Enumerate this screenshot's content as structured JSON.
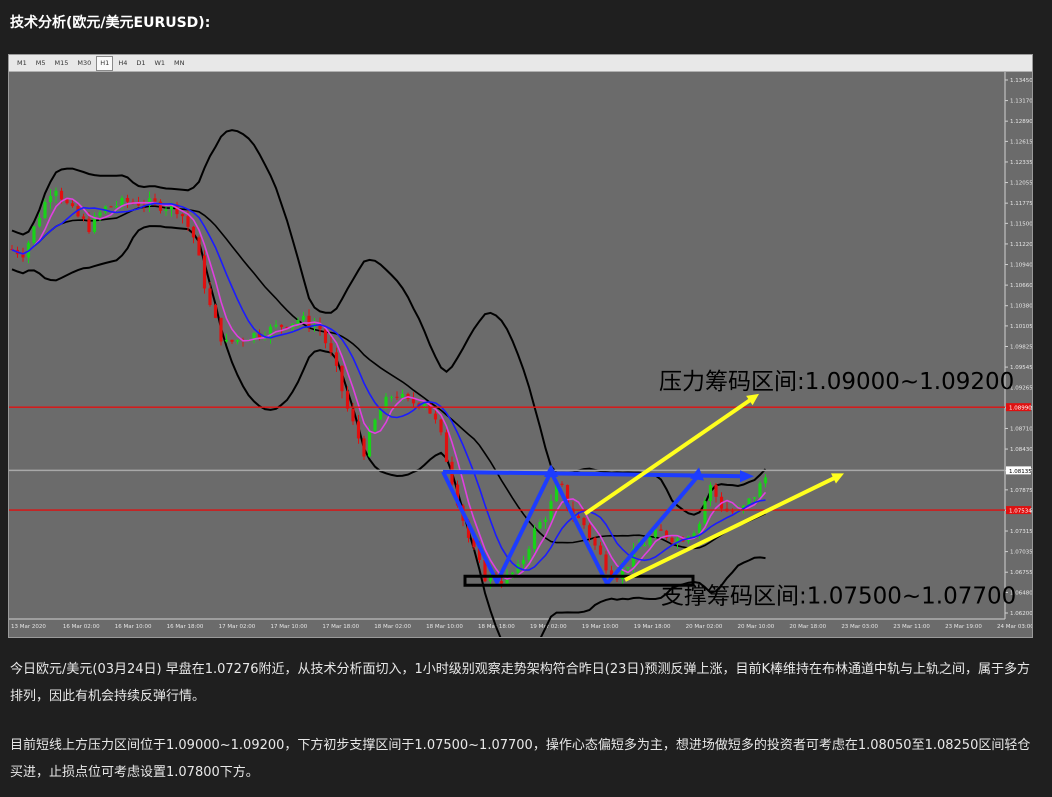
{
  "heading": "技术分析(欧元/美元EURUSD):",
  "timeframes": [
    {
      "label": "M1",
      "active": false
    },
    {
      "label": "M5",
      "active": false
    },
    {
      "label": "M15",
      "active": false
    },
    {
      "label": "M30",
      "active": false
    },
    {
      "label": "H1",
      "active": true
    },
    {
      "label": "H4",
      "active": false
    },
    {
      "label": "D1",
      "active": false
    },
    {
      "label": "W1",
      "active": false
    },
    {
      "label": "MN",
      "active": false
    }
  ],
  "chart_data": {
    "type": "candlestick",
    "symbol": "EURUSD",
    "timeframe": "H1",
    "y_ticks": [
      "1.13450",
      "1.13170",
      "1.12890",
      "1.12615",
      "1.12335",
      "1.12055",
      "1.11775",
      "1.11500",
      "1.11220",
      "1.10940",
      "1.10660",
      "1.10380",
      "1.10105",
      "1.09825",
      "1.09545",
      "1.09265",
      "1.08990",
      "1.08710",
      "1.08430",
      "1.08135",
      "1.07875",
      "1.07595",
      "1.07315",
      "1.07035",
      "1.06755",
      "1.06480",
      "1.06200"
    ],
    "ylim": [
      1.062,
      1.1345
    ],
    "x_ticks": [
      "13 Mar 2020",
      "16 Mar 02:00",
      "16 Mar 10:00",
      "16 Mar 18:00",
      "17 Mar 02:00",
      "17 Mar 10:00",
      "17 Mar 18:00",
      "18 Mar 02:00",
      "18 Mar 10:00",
      "18 Mar 18:00",
      "19 Mar 02:00",
      "19 Mar 10:00",
      "19 Mar 18:00",
      "20 Mar 02:00",
      "20 Mar 10:00",
      "20 Mar 18:00",
      "23 Mar 03:00",
      "23 Mar 11:00",
      "23 Mar 19:00",
      "24 Mar 03:00"
    ],
    "current_price": "1.08135",
    "horizontal_lines": [
      {
        "price": 1.09,
        "color": "#e01010",
        "label": "1.08990"
      },
      {
        "price": 1.076,
        "color": "#e01010",
        "label": "1.07534"
      },
      {
        "price": 1.0814,
        "color": "#a8a8a8",
        "label": ""
      }
    ],
    "annotations": {
      "resistance": "压力筹码区间:1.09000~1.09200",
      "support": "支撑筹码区间:1.07500~1.07700"
    },
    "colors": {
      "background": "#6b6b6b",
      "bull": "#19d219",
      "bear": "#e01010",
      "bollinger": "#000000",
      "ma_fast": "#e040e0",
      "ma_slow": "#1b1bff",
      "pattern": "#1d3cff",
      "channel": "#ffff1e"
    }
  },
  "paragraphs": [
    "今日欧元/美元(03月24日) 早盘在1.07276附近，从技术分析面切入，1小时级别观察走势架构符合昨日(23日)预测反弹上涨，目前K棒维持在布林通道中轨与上轨之间，属于多方排列，因此有机会持续反弹行情。",
    "目前短线上方压力区间位于1.09000~1.09200，下方初步支撑区间于1.07500~1.07700，操作心态偏短多为主，想进场做短多的投资者可考虑在1.08050至1.08250区间轻仓买进，止损点位可考虑设置1.07800下方。"
  ]
}
